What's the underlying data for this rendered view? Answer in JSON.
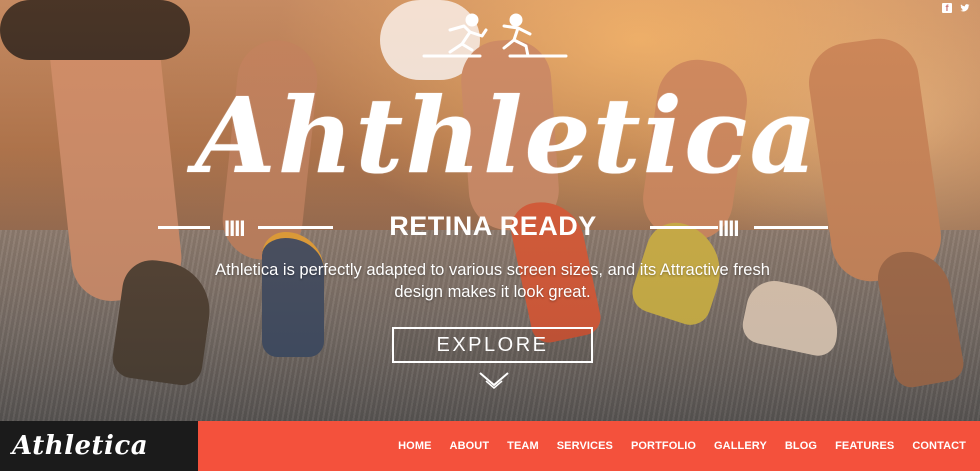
{
  "hero": {
    "title": "Ahthletica",
    "subtitle": "RETINA READY",
    "description": "Athletica is perfectly adapted to various screen sizes, and its Attractive fresh design makes it look great.",
    "explore_label": "EXPLORE",
    "slashes": "IIII"
  },
  "social": {
    "facebook_glyph": "f",
    "twitter_glyph": "🐦"
  },
  "nav": {
    "brand": "Athletica",
    "items": [
      "HOME",
      "ABOUT",
      "TEAM",
      "SERVICES",
      "PORTFOLIO",
      "GALLERY",
      "BLOG",
      "FEATURES",
      "CONTACT"
    ]
  },
  "colors": {
    "accent": "#f4513c",
    "brand_bg": "#1b1b1b"
  },
  "icons": [
    "facebook-icon",
    "twitter-icon",
    "runners-logo-icon",
    "chevron-down-icon"
  ]
}
